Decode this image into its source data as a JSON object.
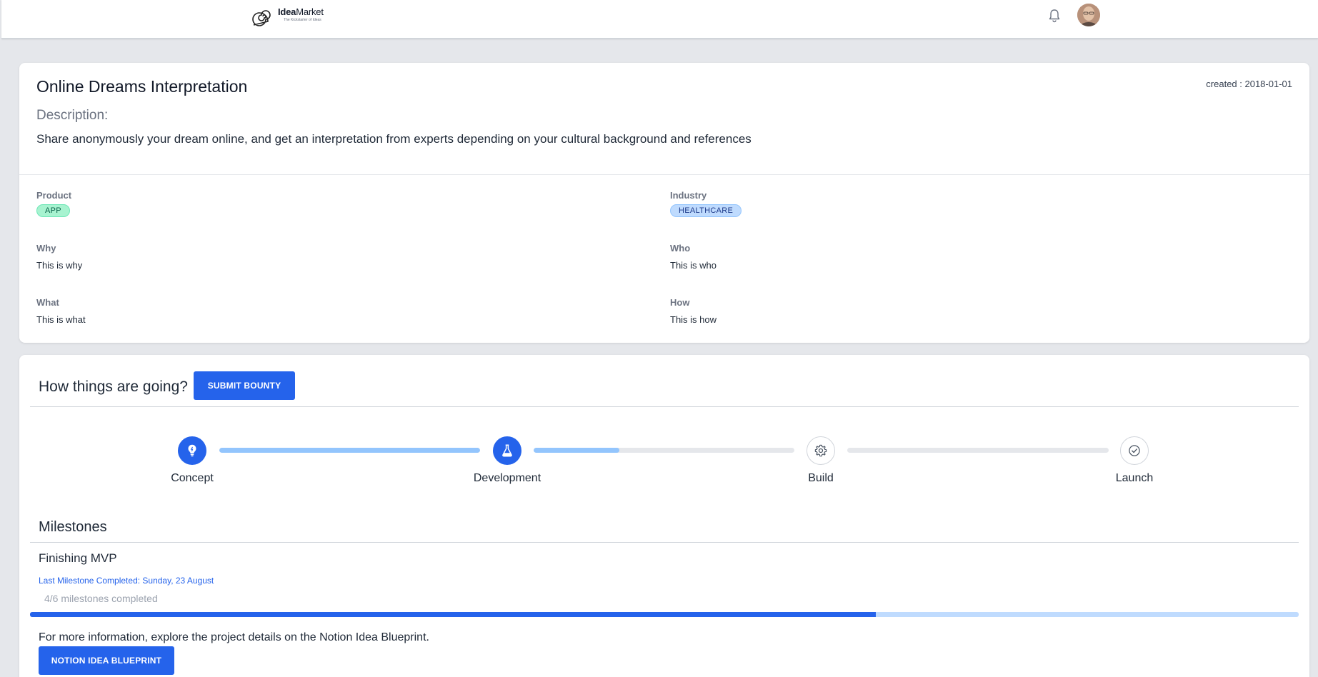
{
  "header": {
    "logo_name_bold": "Idea",
    "logo_name_rest": "Market",
    "logo_tagline": "The Kickstarter of Ideas",
    "bell_icon": "bell-icon",
    "avatar_icon": "user-avatar"
  },
  "idea": {
    "title": "Online Dreams Interpretation",
    "created": "created : 2018-01-01",
    "description_label": "Description:",
    "description": "Share anonymously your dream online, and get an interpretation from experts depending on your cultural background and references",
    "product_label": "Product",
    "product_badge": "APP",
    "industry_label": "Industry",
    "industry_badge": "HEALTHCARE",
    "why_label": "Why",
    "why_value": "This is why",
    "who_label": "Who",
    "who_value": "This is who",
    "what_label": "What",
    "what_value": "This is what",
    "how_label": "How",
    "how_value": "This is how"
  },
  "progress": {
    "title": "How things are going?",
    "submit_bounty_label": "SUBMIT BOUNTY",
    "steps": [
      {
        "label": "Concept",
        "icon": "lightbulb-icon",
        "active": true
      },
      {
        "label": "Development",
        "icon": "flask-icon",
        "active": true
      },
      {
        "label": "Build",
        "icon": "gear-icon",
        "active": false
      },
      {
        "label": "Launch",
        "icon": "check-circle-icon",
        "active": false
      }
    ],
    "track_fill": [
      1.0,
      0.33,
      0.0
    ]
  },
  "milestones": {
    "title": "Milestones",
    "current": "Finishing MVP",
    "last_completed": "Last Milestone Completed: Sunday, 23 August",
    "count_text": "4/6 milestones completed",
    "completed": 4,
    "total": 6,
    "more_info": "For more information, explore the project details on the Notion Idea Blueprint.",
    "notion_button_label": "NOTION IDEA BLUEPRINT"
  },
  "colors": {
    "accent": "#2563eb",
    "track_light": "#93c5fd",
    "page_bg": "#e5e7eb"
  }
}
